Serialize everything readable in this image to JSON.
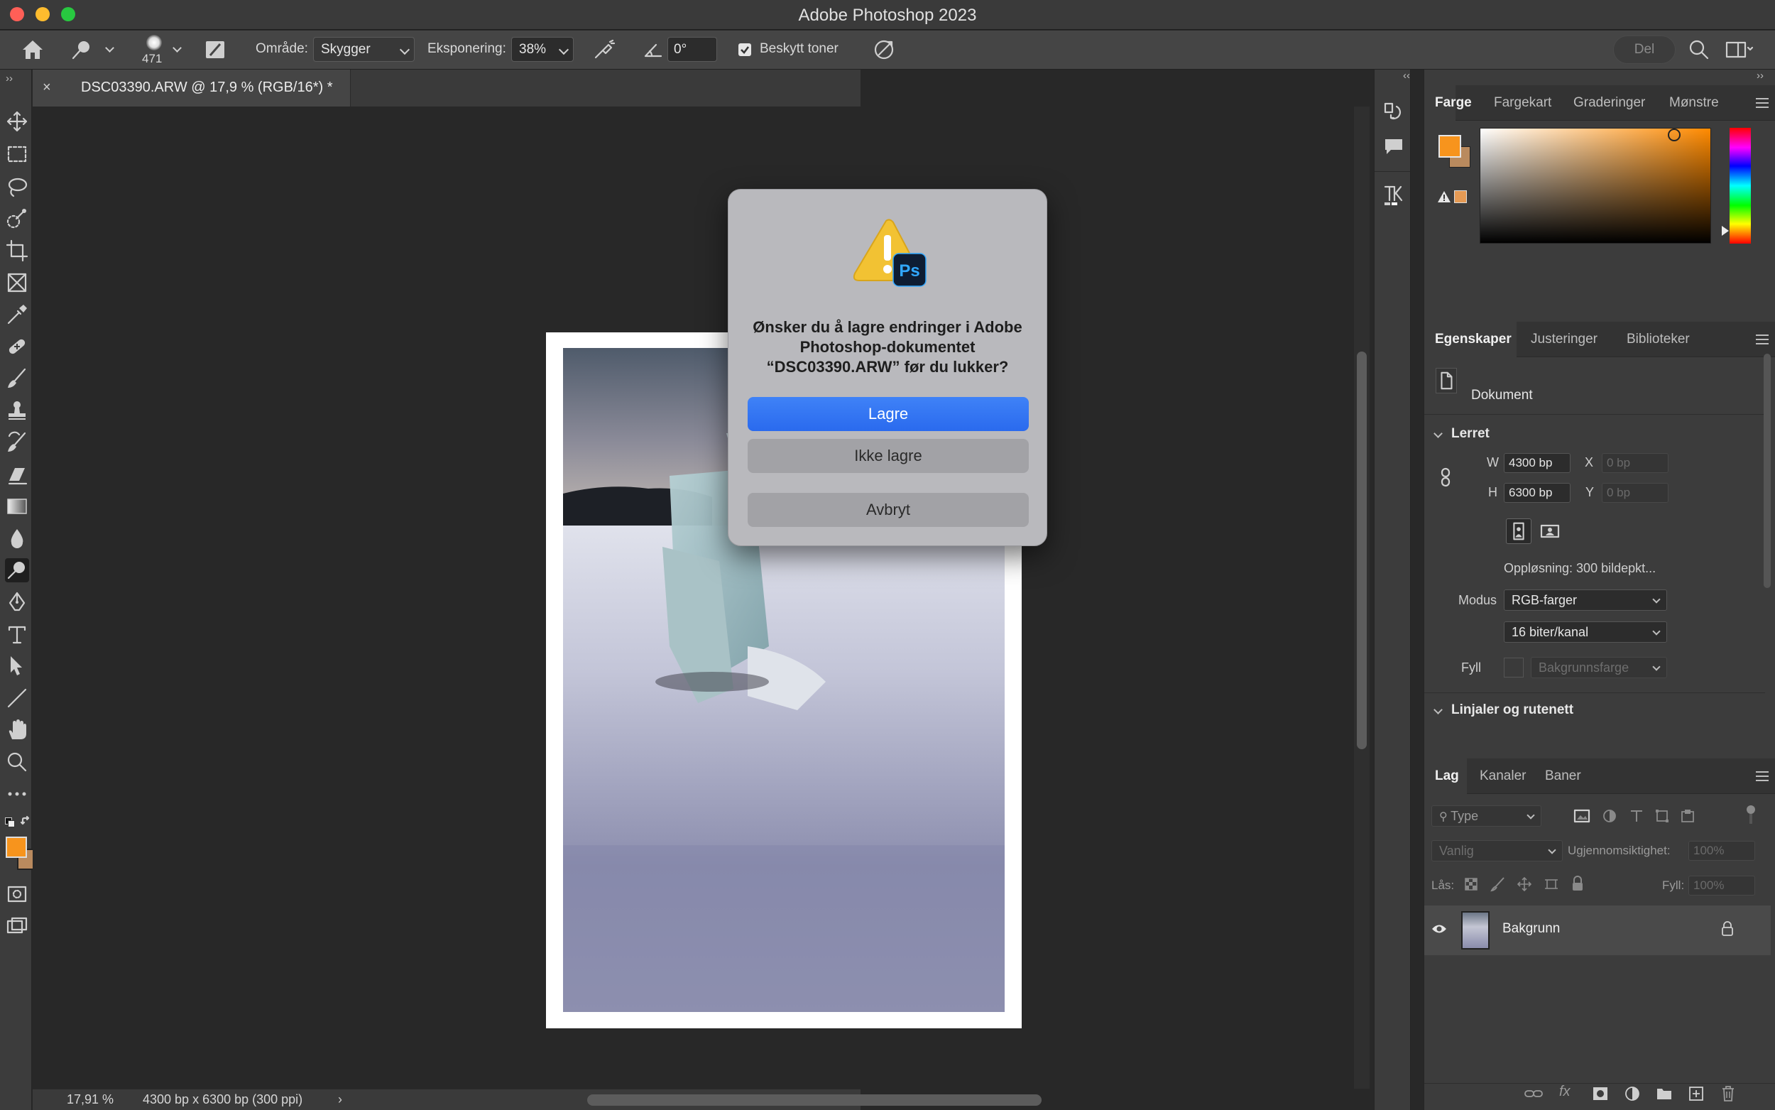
{
  "window": {
    "title": "Adobe Photoshop 2023"
  },
  "options_bar": {
    "brush_size": "471",
    "range_label": "Område:",
    "range_value": "Skygger",
    "exposure_label": "Eksponering:",
    "exposure_value": "38%",
    "angle_value": "0°",
    "protect_tones_label": "Beskytt toner",
    "share_label": "Del"
  },
  "document_tab": {
    "title": "DSC03390.ARW @ 17,9 % (RGB/16*) *",
    "close": "×"
  },
  "status_bar": {
    "zoom": "17,91 %",
    "doc_info": "4300 bp x 6300 bp (300 ppi)"
  },
  "dialog": {
    "message": "Ønsker du å lagre endringer i Adobe Photoshop-dokumentet “DSC03390.ARW” før du lukker?",
    "save": "Lagre",
    "dont_save": "Ikke lagre",
    "cancel": "Avbryt",
    "badge": "Ps"
  },
  "color_panel": {
    "tabs": [
      "Farge",
      "Fargekart",
      "Graderinger",
      "Mønstre"
    ],
    "active_tab": "Farge",
    "foreground_color": "#F7941D",
    "background_color": "#B98A5E"
  },
  "properties_panel": {
    "tabs": [
      "Egenskaper",
      "Justeringer",
      "Biblioteker"
    ],
    "kind": "Dokument",
    "canvas_section": "Lerret",
    "w_label": "W",
    "w_value": "4300 bp",
    "h_label": "H",
    "h_value": "6300 bp",
    "x_label": "X",
    "x_placeholder": "0 bp",
    "y_label": "Y",
    "y_placeholder": "0 bp",
    "resolution": "Oppløsning: 300 bildepkt...",
    "mode_label": "Modus",
    "mode_value": "RGB-farger",
    "depth_value": "16 biter/kanal",
    "fill_label": "Fyll",
    "fill_value": "Bakgrunnsfarge",
    "rulers_section": "Linjaler og rutenett"
  },
  "layers_panel": {
    "tabs": [
      "Lag",
      "Kanaler",
      "Baner"
    ],
    "filter_placeholder": "Type",
    "blend_mode": "Vanlig",
    "opacity_label": "Ugjennomsiktighet:",
    "opacity_value": "100%",
    "lock_label": "Lås:",
    "fill_label": "Fyll:",
    "fill_value": "100%",
    "layers": [
      {
        "name": "Bakgrunn",
        "visible": true,
        "locked": true
      }
    ]
  },
  "colors": {
    "accent_blue": "#2D6FF2",
    "traffic_red": "#FF5F57",
    "traffic_yellow": "#FEBC2E",
    "traffic_green": "#28C840"
  }
}
